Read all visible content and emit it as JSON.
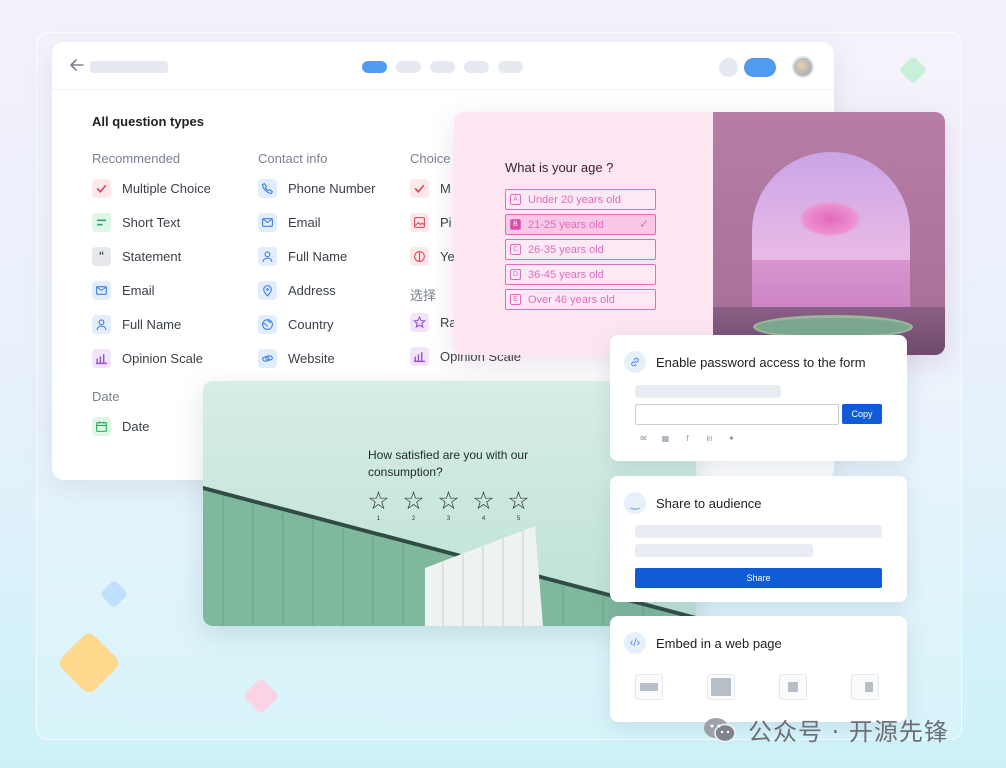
{
  "builder": {
    "heading": "All question types",
    "columns": [
      {
        "title": "Recommended",
        "items": [
          {
            "label": "Multiple Choice",
            "icon": "check-icon",
            "color": "red"
          },
          {
            "label": "Short Text",
            "icon": "short-text-icon",
            "color": "green"
          },
          {
            "label": "Statement",
            "icon": "quote-icon",
            "color": "gray"
          },
          {
            "label": "Email",
            "icon": "mail-icon",
            "color": "blue"
          },
          {
            "label": "Full Name",
            "icon": "person-icon",
            "color": "blue"
          },
          {
            "label": "Opinion Scale",
            "icon": "bar-chart-icon",
            "color": "purple"
          }
        ]
      },
      {
        "title": "Contact info",
        "items": [
          {
            "label": "Phone Number",
            "icon": "phone-icon",
            "color": "blue"
          },
          {
            "label": "Email",
            "icon": "mail-icon",
            "color": "blue"
          },
          {
            "label": "Full Name",
            "icon": "person-icon",
            "color": "blue"
          },
          {
            "label": "Address",
            "icon": "location-pin-icon",
            "color": "blue"
          },
          {
            "label": "Country",
            "icon": "globe-icon",
            "color": "blue"
          },
          {
            "label": "Website",
            "icon": "link-icon",
            "color": "blue"
          }
        ]
      },
      {
        "title": "Choice",
        "items": [
          {
            "label": "M",
            "icon": "check-icon",
            "color": "red"
          },
          {
            "label": "Pi",
            "icon": "image-icon",
            "color": "red"
          },
          {
            "label": "Ye",
            "icon": "yes-no-icon",
            "color": "red"
          }
        ]
      }
    ],
    "section2": {
      "title": "选择",
      "items": [
        {
          "label": "Ra",
          "icon": "star-icon",
          "color": "purple"
        },
        {
          "label": "Opinion Scale",
          "icon": "bar-chart-icon",
          "color": "purple"
        }
      ]
    },
    "date_section": {
      "title": "Date",
      "items": [
        {
          "label": "Date",
          "icon": "calendar-icon",
          "color": "green"
        }
      ]
    }
  },
  "age_question": {
    "question": "What is your age ?",
    "options": [
      {
        "key": "A",
        "label": "Under 20 years old",
        "selected": false
      },
      {
        "key": "B",
        "label": "21-25 years old",
        "selected": true
      },
      {
        "key": "C",
        "label": "26-35 years old",
        "selected": false
      },
      {
        "key": "D",
        "label": "36-45 years old",
        "selected": false
      },
      {
        "key": "E",
        "label": "Over 46 years old",
        "selected": false
      }
    ],
    "check_glyph": "✓"
  },
  "satisfaction": {
    "question": "How satisfied are you with our consumption?",
    "star_glyph": "☆",
    "ratings": [
      "1",
      "2",
      "3",
      "4",
      "5"
    ]
  },
  "password_panel": {
    "title": "Enable password access to the form",
    "copy_label": "Copy",
    "socials": [
      "mail-icon",
      "qr-icon",
      "facebook-icon",
      "linkedin-icon",
      "twitter-icon"
    ]
  },
  "share_panel": {
    "title": "Share to audience",
    "share_label": "Share"
  },
  "embed_panel": {
    "title": "Embed in a web page",
    "options": [
      "embed-standard-icon",
      "embed-fullpage-icon",
      "embed-popup-icon",
      "embed-slider-icon"
    ]
  },
  "watermark": {
    "text": "公众号 · 开源先锋"
  },
  "colors": {
    "accent_blue": "#0f5cd6",
    "step_active": "#4f9bf0",
    "age_pink": "#e06bc0"
  }
}
